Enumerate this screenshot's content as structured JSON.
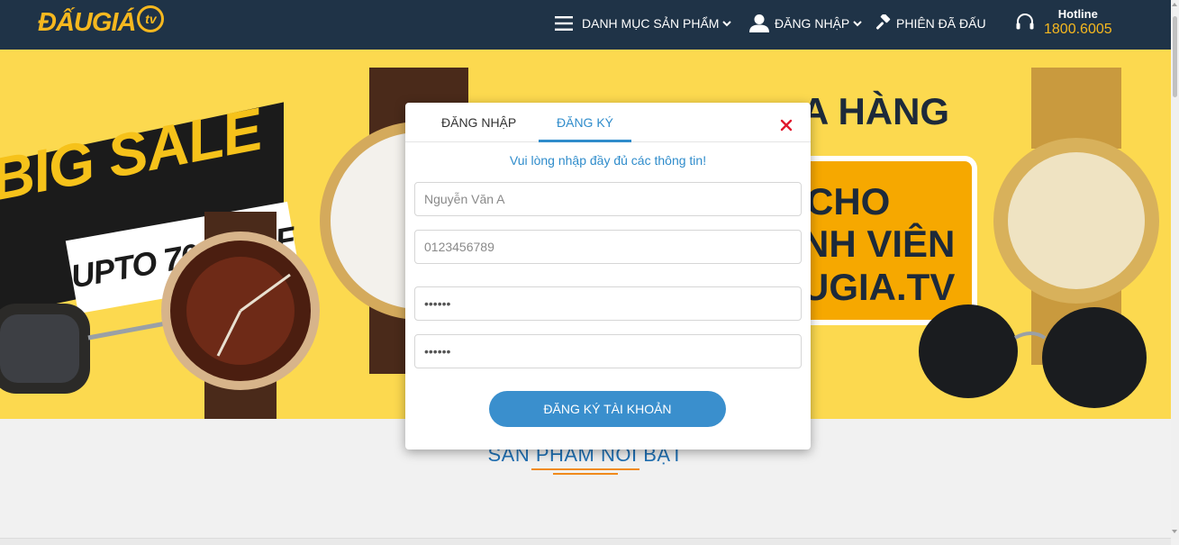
{
  "header": {
    "logo_text": "ĐẤUGIÁ",
    "logo_badge": "tv",
    "menu_label": "DANH MỤC SẢN PHẨM",
    "login_label": "ĐĂNG NHẬP",
    "bids_label": "PHIÊN ĐÃ ĐẤU",
    "hotline_title": "Hotline",
    "hotline_number": "1800.6005",
    "brand_color": "#f6b81f"
  },
  "banner": {
    "big_sale": "BIG SALE",
    "upto": "UPTO 70% OFF",
    "promo_line1": "A HÀNG",
    "promo_line2": "CHO",
    "promo_line3": "NH VIÊN",
    "promo_line4": "UGIA.TV"
  },
  "section": {
    "title": "SẢN PHẨM NỔI BẬT"
  },
  "modal": {
    "tab_login": "ĐĂNG NHẬP",
    "tab_register": "ĐĂNG KÝ",
    "active_tab": "ĐĂNG KÝ",
    "message": "Vui lòng nhập đầy đủ các thông tin!",
    "name_placeholder": "Nguyễn Văn A",
    "phone_placeholder": "0123456789",
    "password_value": "••••••",
    "password_confirm_value": "••••••",
    "submit_label": "ĐĂNG KÝ TÀI KHOẢN",
    "accent_color": "#2f8ccb",
    "close_color": "#e0182d"
  }
}
